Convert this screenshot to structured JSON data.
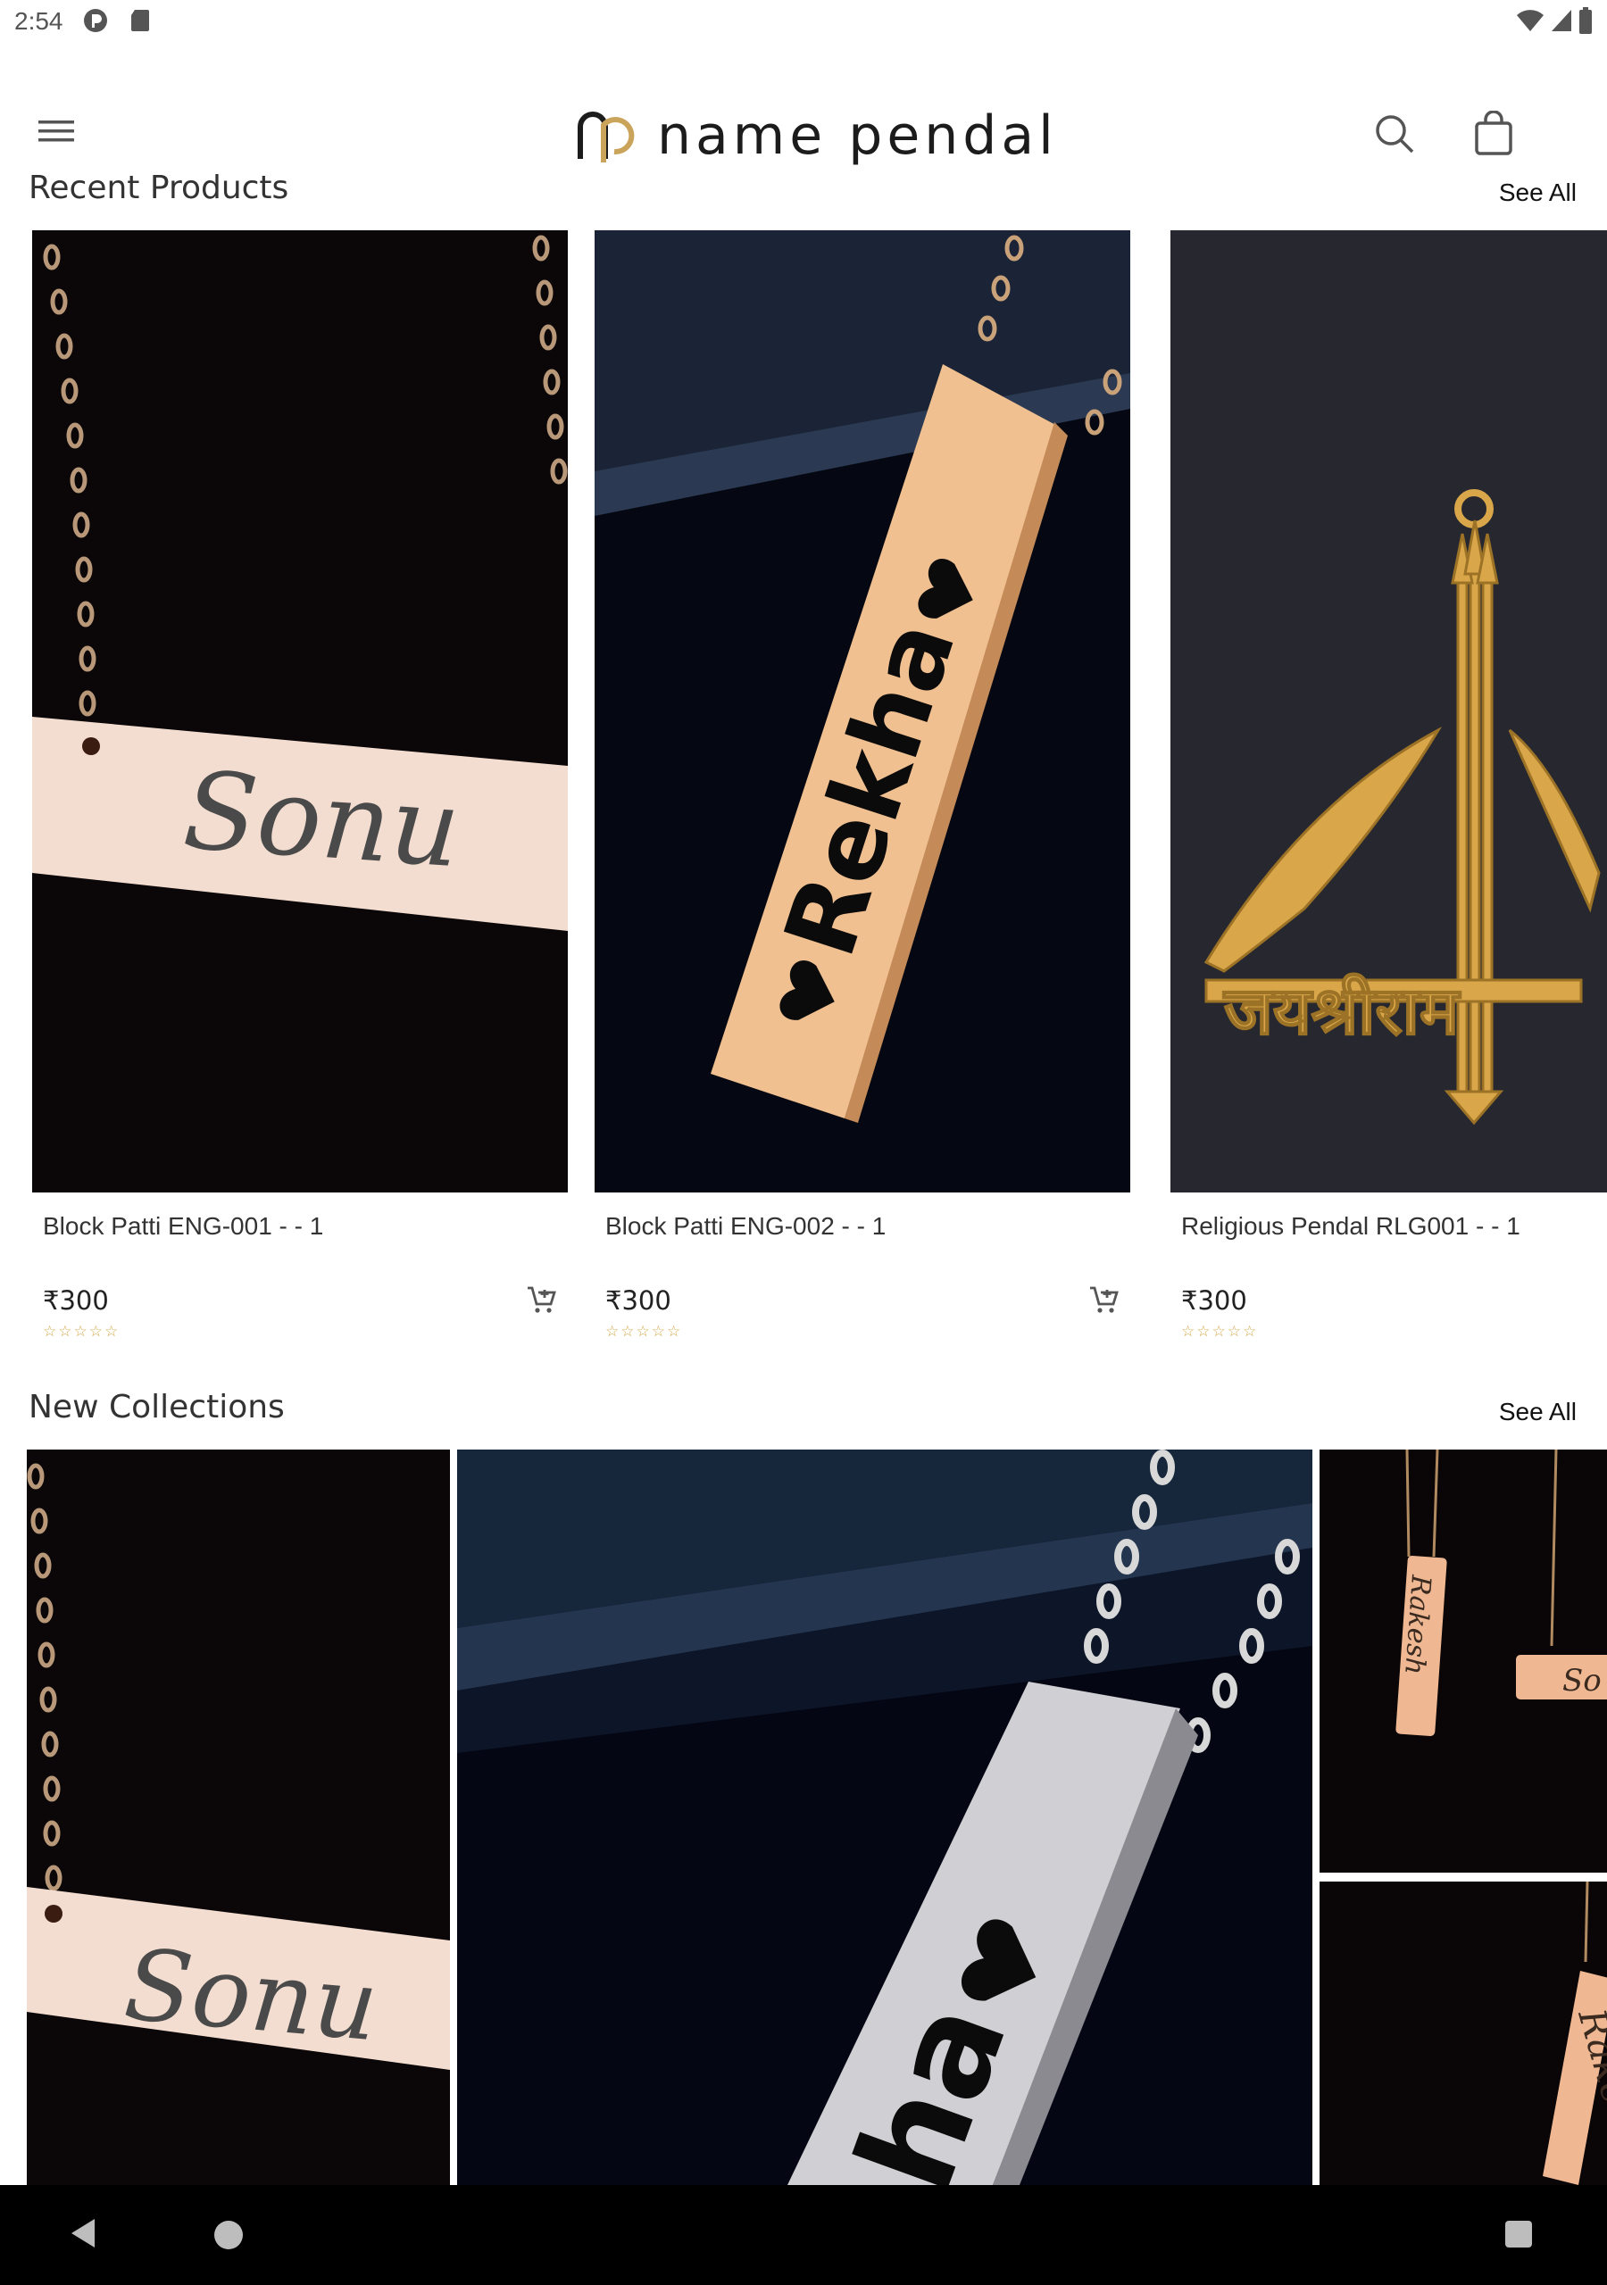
{
  "status_bar": {
    "time": "2:54"
  },
  "app_bar": {
    "brand_name": "name pendal"
  },
  "recent_products": {
    "title": "Recent Products",
    "see_all": "See All",
    "items": [
      {
        "name": "Block Patti ENG-001 - - 1",
        "price": "₹300",
        "rating": "☆☆☆☆☆",
        "engraving": "Sonu"
      },
      {
        "name": "Block Patti ENG-002 - - 1",
        "price": "₹300",
        "rating": "☆☆☆☆☆",
        "engraving": "Rekha"
      },
      {
        "name": "Religious Pendal RLG001 - - 1",
        "price": "₹300",
        "rating": "☆☆☆☆☆",
        "engraving": "जयश्रीराम"
      }
    ]
  },
  "new_collections": {
    "title": "New Collections",
    "see_all": "See All",
    "tiles": [
      {
        "engraving": "Sonu"
      },
      {
        "engraving": "ha"
      },
      {
        "engraving": "Rakesh"
      },
      {
        "engraving": "So"
      },
      {
        "engraving": "Rake"
      }
    ]
  },
  "colors": {
    "gold": "#d8a24a",
    "rose_gold": "#f0c7a0",
    "accent": "#caa45a"
  }
}
